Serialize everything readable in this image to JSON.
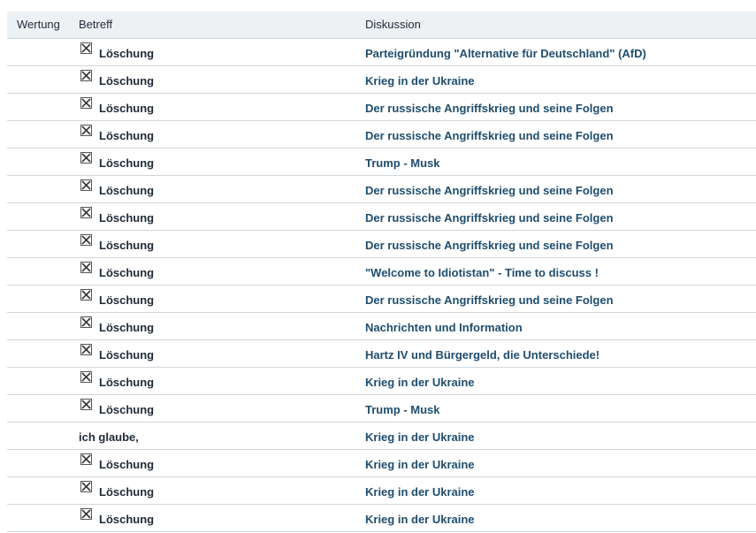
{
  "table": {
    "headers": {
      "rating": "Wertung",
      "subject": "Betreff",
      "discussion": "Diskussion"
    },
    "rows": [
      {
        "subject": "Löschung",
        "deleted": true,
        "discussion": "Parteigründung \"Alternative für Deutschland\" (AfD)"
      },
      {
        "subject": "Löschung",
        "deleted": true,
        "discussion": "Krieg in der Ukraine"
      },
      {
        "subject": "Löschung",
        "deleted": true,
        "discussion": "Der russische Angriffskrieg und seine Folgen"
      },
      {
        "subject": "Löschung",
        "deleted": true,
        "discussion": "Der russische Angriffskrieg und seine Folgen"
      },
      {
        "subject": "Löschung",
        "deleted": true,
        "discussion": "Trump - Musk"
      },
      {
        "subject": "Löschung",
        "deleted": true,
        "discussion": "Der russische Angriffskrieg und seine Folgen"
      },
      {
        "subject": "Löschung",
        "deleted": true,
        "discussion": "Der russische Angriffskrieg und seine Folgen"
      },
      {
        "subject": "Löschung",
        "deleted": true,
        "discussion": "Der russische Angriffskrieg und seine Folgen"
      },
      {
        "subject": "Löschung",
        "deleted": true,
        "discussion": "\"Welcome to Idiotistan\" - Time to discuss !"
      },
      {
        "subject": "Löschung",
        "deleted": true,
        "discussion": "Der russische Angriffskrieg und seine Folgen"
      },
      {
        "subject": "Löschung",
        "deleted": true,
        "discussion": "Nachrichten und Information"
      },
      {
        "subject": "Löschung",
        "deleted": true,
        "discussion": "Hartz IV und Bürgergeld, die Unterschiede!"
      },
      {
        "subject": "Löschung",
        "deleted": true,
        "discussion": "Krieg in der Ukraine"
      },
      {
        "subject": "Löschung",
        "deleted": true,
        "discussion": "Trump - Musk"
      },
      {
        "subject": "ich glaube,",
        "deleted": false,
        "discussion": "Krieg in der Ukraine"
      },
      {
        "subject": "Löschung",
        "deleted": true,
        "discussion": "Krieg in der Ukraine"
      },
      {
        "subject": "Löschung",
        "deleted": true,
        "discussion": "Krieg in der Ukraine"
      },
      {
        "subject": "Löschung",
        "deleted": true,
        "discussion": "Krieg in der Ukraine"
      }
    ]
  },
  "icons": {
    "deleted": "deleted-post-icon"
  },
  "colors": {
    "header_bg": "#eef1f3",
    "row_border": "#cfd7dd",
    "link": "#1f4d6e",
    "title": "#153f61"
  }
}
